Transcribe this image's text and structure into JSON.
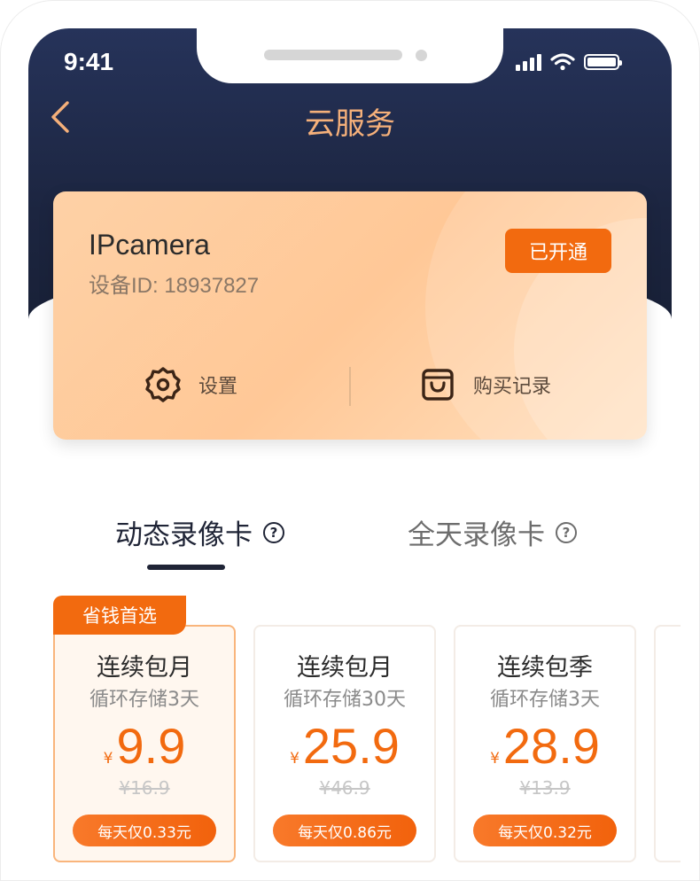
{
  "status_bar": {
    "time": "9:41"
  },
  "nav": {
    "title": "云服务"
  },
  "device": {
    "name": "IPcamera",
    "id_label": "设备ID: 18937827",
    "status": "已开通",
    "actions": [
      {
        "label": "设置",
        "icon": "gear-icon"
      },
      {
        "label": "购买记录",
        "icon": "shopping-bag-icon"
      }
    ]
  },
  "tabs": [
    {
      "label": "动态录像卡",
      "active": true
    },
    {
      "label": "全天录像卡",
      "active": false
    }
  ],
  "plans": {
    "ribbon": "省钱首选",
    "items": [
      {
        "name": "连续包月",
        "desc": "循环存储3天",
        "currency": "¥",
        "price": "9.9",
        "original": "¥16.9",
        "daily": "每天仅0.33元",
        "selected": true
      },
      {
        "name": "连续包月",
        "desc": "循环存储30天",
        "currency": "¥",
        "price": "25.9",
        "original": "¥46.9",
        "daily": "每天仅0.86元",
        "selected": false
      },
      {
        "name": "连续包季",
        "desc": "循环存储3天",
        "currency": "¥",
        "price": "28.9",
        "original": "¥13.9",
        "daily": "每天仅0.32元",
        "selected": false
      }
    ]
  },
  "colors": {
    "header_bg": "#1c2540",
    "accent_orange": "#f26a0f",
    "title_orange": "#f5b07a",
    "card_peach": "#ffc897"
  }
}
